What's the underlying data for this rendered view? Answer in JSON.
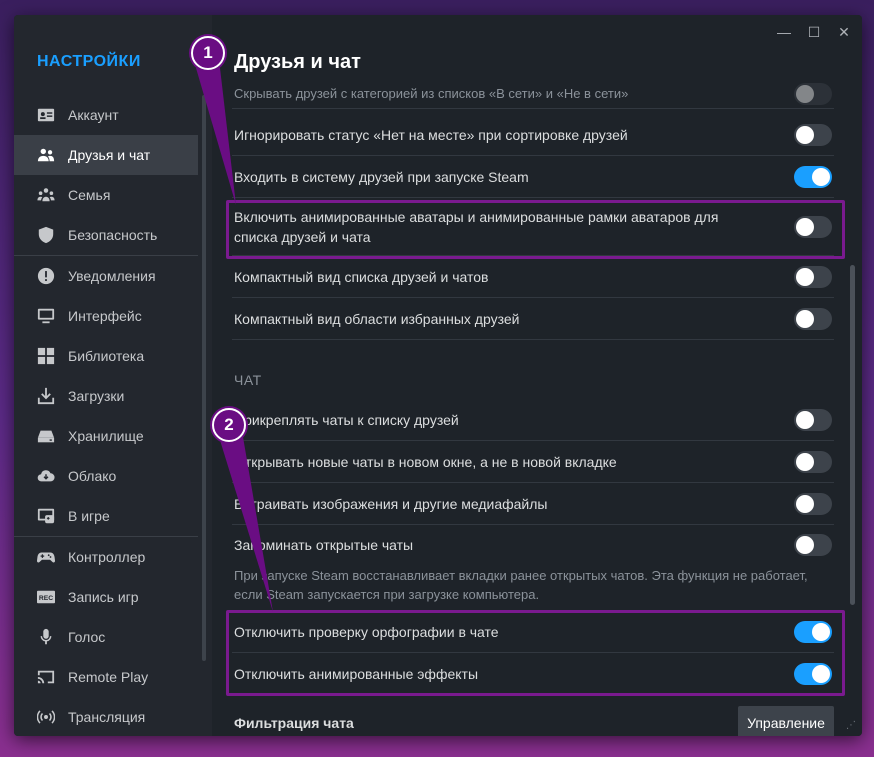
{
  "sidebar": {
    "title": "НАСТРОЙКИ",
    "items": [
      {
        "label": "Аккаунт",
        "icon": "account-card-icon"
      },
      {
        "label": "Друзья и чат",
        "icon": "friends-icon"
      },
      {
        "label": "Семья",
        "icon": "family-icon"
      },
      {
        "label": "Безопасность",
        "icon": "shield-icon"
      },
      {
        "label": "Уведомления",
        "icon": "notification-icon"
      },
      {
        "label": "Интерфейс",
        "icon": "monitor-icon"
      },
      {
        "label": "Библиотека",
        "icon": "grid-icon"
      },
      {
        "label": "Загрузки",
        "icon": "download-icon"
      },
      {
        "label": "Хранилище",
        "icon": "storage-icon"
      },
      {
        "label": "Облако",
        "icon": "cloud-icon"
      },
      {
        "label": "В игре",
        "icon": "ingame-icon"
      },
      {
        "label": "Контроллер",
        "icon": "gamepad-icon"
      },
      {
        "label": "Запись игр",
        "icon": "rec-icon"
      },
      {
        "label": "Голос",
        "icon": "microphone-icon"
      },
      {
        "label": "Remote Play",
        "icon": "cast-icon"
      },
      {
        "label": "Трансляция",
        "icon": "broadcast-icon"
      }
    ],
    "active_index": 1
  },
  "window_controls": {
    "minimize": "—",
    "maximize": "☐",
    "close": "✕"
  },
  "page": {
    "title": "Друзья и чат",
    "rows_top": [
      {
        "label": "Скрывать друзей с категорией из списков «В сети» и «Не в сети»",
        "on": false
      },
      {
        "label": "Игнорировать статус «Нет на месте» при сортировке друзей",
        "on": false
      },
      {
        "label": "Входить в систему друзей при запуске Steam",
        "on": true
      },
      {
        "label": "Включить анимированные аватары и анимированные рамки аватаров для списка друзей и чата",
        "on": false
      },
      {
        "label": "Компактный вид списка друзей и чатов",
        "on": false
      },
      {
        "label": "Компактный вид области избранных друзей",
        "on": false
      }
    ],
    "chat_section_title": "ЧАТ",
    "rows_chat": [
      {
        "label": "Прикреплять чаты к списку друзей",
        "on": false
      },
      {
        "label": "Открывать новые чаты в новом окне, а не в новой вкладке",
        "on": false
      },
      {
        "label": "Встраивать изображения и другие медиафайлы",
        "on": false
      },
      {
        "label": "Запоминать открытые чаты",
        "on": false
      }
    ],
    "remember_hint": "При запуске Steam восстанавливает вкладки ранее открытых чатов. Эта функция не работает, если Steam запускается при загрузке компьютера.",
    "rows_bottom": [
      {
        "label": "Отключить проверку орфографии в чате",
        "on": true
      },
      {
        "label": "Отключить анимированные эффекты",
        "on": true
      }
    ],
    "filter_label": "Фильтрация чата",
    "manage_button": "Управление"
  },
  "annotations": {
    "badge_1": "1",
    "badge_2": "2"
  },
  "colors": {
    "accent": "#1a9fff",
    "highlight": "#7a1a8f",
    "background": "#1e2329",
    "sidebar": "#23272e"
  }
}
